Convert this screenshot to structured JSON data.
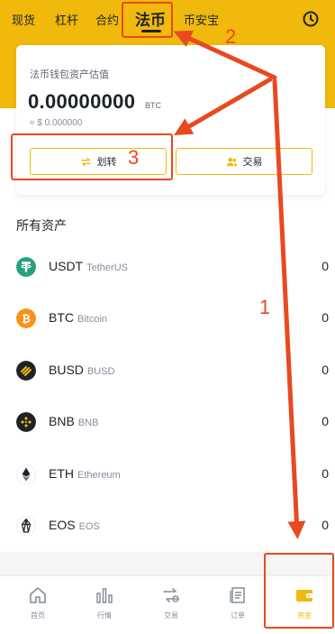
{
  "tabs": [
    {
      "label": "现货"
    },
    {
      "label": "杠杆"
    },
    {
      "label": "合约"
    },
    {
      "label": "法币"
    },
    {
      "label": "币安宝"
    }
  ],
  "wallet": {
    "label": "法币钱包资产估值",
    "balance": "0.00000000",
    "unit": "BTC",
    "fiat": "≈ $ 0.000000",
    "transfer_label": "划转",
    "trade_label": "交易"
  },
  "assets_title": "所有资产",
  "assets": [
    {
      "symbol": "USDT",
      "name": "TetherUS",
      "amount": "0",
      "color": "#26a17b"
    },
    {
      "symbol": "BTC",
      "name": "Bitcoin",
      "amount": "0",
      "color": "#f7931a"
    },
    {
      "symbol": "BUSD",
      "name": "BUSD",
      "amount": "0",
      "color": "#1e2329"
    },
    {
      "symbol": "BNB",
      "name": "BNB",
      "amount": "0",
      "color": "#1e2329"
    },
    {
      "symbol": "ETH",
      "name": "Ethereum",
      "amount": "0",
      "color": "#ffffff"
    },
    {
      "symbol": "EOS",
      "name": "EOS",
      "amount": "0",
      "color": "#ffffff"
    }
  ],
  "nav": [
    {
      "label": "首页",
      "icon": "home-icon"
    },
    {
      "label": "行情",
      "icon": "markets-icon"
    },
    {
      "label": "交易",
      "icon": "trade-icon"
    },
    {
      "label": "订单",
      "icon": "orders-icon"
    },
    {
      "label": "资金",
      "icon": "wallet-icon"
    }
  ],
  "annotations": {
    "one": "1",
    "two": "2",
    "three": "3"
  },
  "colors": {
    "brand": "#f0b90b",
    "annotation": "#e8491f"
  }
}
